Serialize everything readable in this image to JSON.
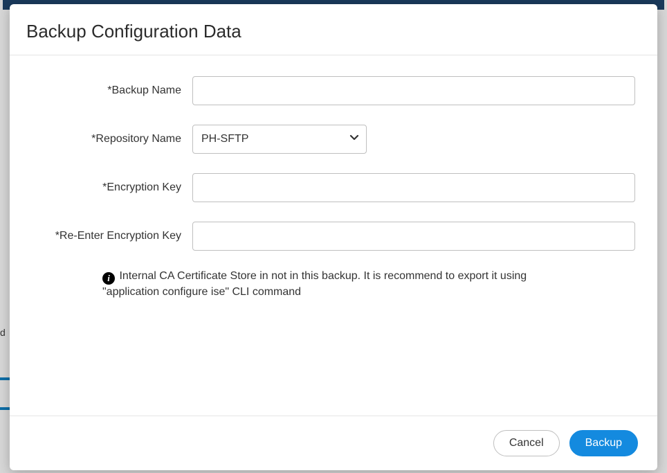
{
  "modal": {
    "title": "Backup Configuration Data"
  },
  "form": {
    "backupName": {
      "label": "*Backup Name",
      "value": ""
    },
    "repositoryName": {
      "label": "*Repository Name",
      "selected": "PH-SFTP"
    },
    "encryptionKey": {
      "label": "*Encryption Key",
      "value": ""
    },
    "reEncryptionKey": {
      "label": "*Re-Enter Encryption Key",
      "value": ""
    },
    "infoNote": "Internal CA Certificate Store in not in this backup. It is recommend to export it using \"application configure ise\" CLI command"
  },
  "footer": {
    "cancel": "Cancel",
    "backup": "Backup"
  },
  "backdrop": {
    "frag": "d"
  }
}
